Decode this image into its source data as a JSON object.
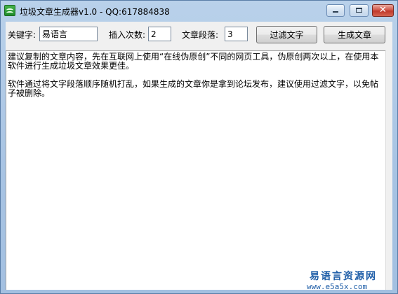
{
  "window": {
    "title": "垃圾文章生成器v1.0 - QQ:617884838",
    "close_glyph": "✕"
  },
  "form": {
    "keyword_label": "关键字:",
    "keyword_value": "易语言",
    "insert_count_label": "插入次数:",
    "insert_count_value": "2",
    "paragraphs_label": "文章段落:",
    "paragraphs_value": "3",
    "filter_button": "过滤文字",
    "generate_button": "生成文章"
  },
  "editor": {
    "paragraphs": [
      "建议复制的文章内容，先在互联网上使用“在线伪原创”不同的网页工具，伪原创两次以上，在使用本软件进行生成垃圾文章效果更佳。",
      "软件通过将文字段落顺序随机打乱，如果生成的文章你是拿到论坛发布，建议使用过滤文字，以免帖子被删除。"
    ]
  },
  "watermark": {
    "name": "易语言资源网",
    "url": "www.e5a5x.com"
  },
  "icons": {
    "app": "app-logo-icon",
    "minimize": "minimize-icon",
    "maximize": "maximize-icon",
    "close": "close-icon"
  }
}
